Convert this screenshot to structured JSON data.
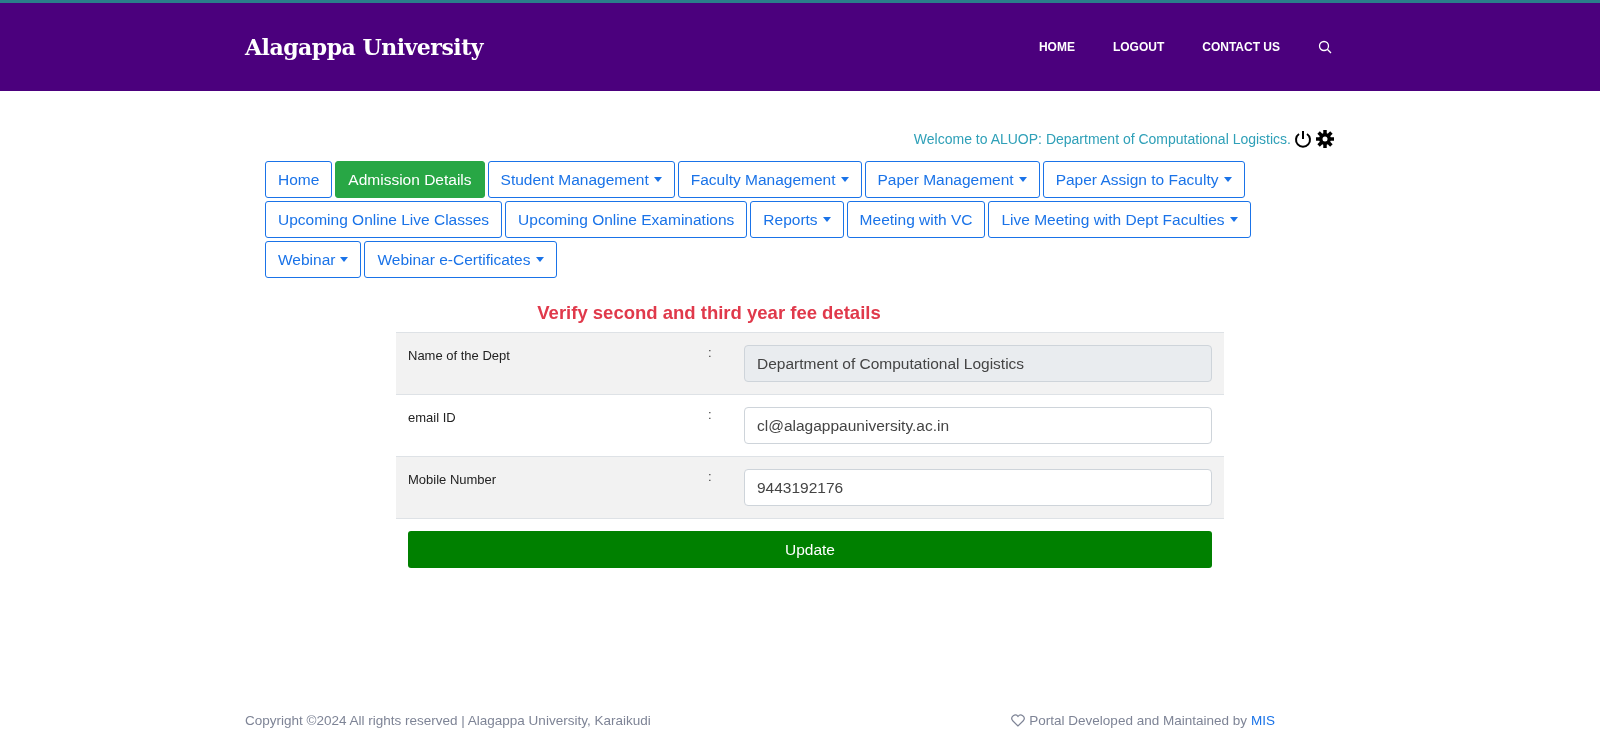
{
  "header": {
    "brand": "Alagappa University",
    "links": [
      "HOME",
      "LOGOUT",
      "CONTACT US"
    ]
  },
  "welcome": "Welcome to ALUOP: Department of Computational Logistics.",
  "menu": [
    {
      "label": "Home",
      "selected": false,
      "dropdown": false
    },
    {
      "label": "Admission Details",
      "selected": true,
      "dropdown": false
    },
    {
      "label": "Student Management",
      "selected": false,
      "dropdown": true
    },
    {
      "label": "Faculty Management",
      "selected": false,
      "dropdown": true
    },
    {
      "label": "Paper Management",
      "selected": false,
      "dropdown": true
    },
    {
      "label": "Paper Assign to Faculty",
      "selected": false,
      "dropdown": true
    },
    {
      "label": "Upcoming Online Live Classes",
      "selected": false,
      "dropdown": false
    },
    {
      "label": "Upcoming Online Examinations",
      "selected": false,
      "dropdown": false
    },
    {
      "label": "Reports",
      "selected": false,
      "dropdown": true
    },
    {
      "label": "Meeting with VC",
      "selected": false,
      "dropdown": false
    },
    {
      "label": "Live Meeting with Dept Faculties",
      "selected": false,
      "dropdown": true
    },
    {
      "label": "Webinar",
      "selected": false,
      "dropdown": true
    },
    {
      "label": "Webinar e-Certificates",
      "selected": false,
      "dropdown": true
    }
  ],
  "form": {
    "title": "Verify second and third year fee details",
    "rows": [
      {
        "label": "Name of the Dept",
        "separator": ":",
        "value": "Department of Computational Logistics",
        "disabled": true
      },
      {
        "label": "email ID",
        "separator": ":",
        "value": "cl@alagappauniversity.ac.in",
        "disabled": false
      },
      {
        "label": "Mobile Number",
        "separator": ":",
        "value": "9443192176",
        "disabled": false
      }
    ],
    "button": "Update"
  },
  "footer": {
    "copyright": "Copyright ©2024 All rights reserved | Alagappa University, Karaikudi",
    "credit": "Portal Developed and Maintained by",
    "credit_link": "MIS"
  }
}
